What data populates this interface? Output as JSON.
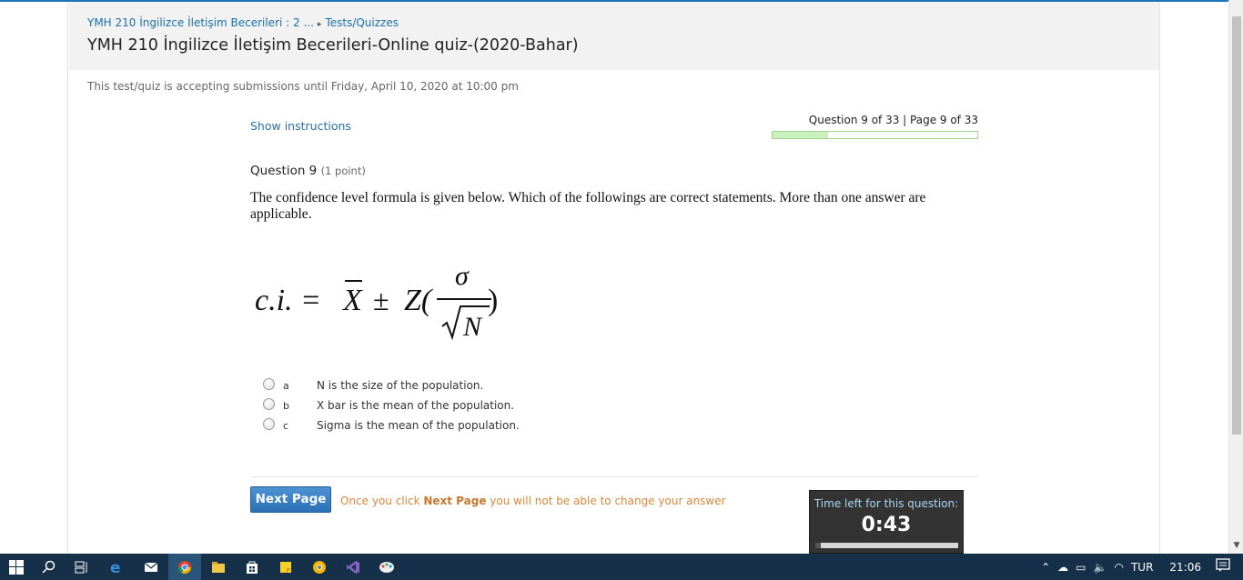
{
  "breadcrumb": {
    "course": "YMH 210 İngilizce İletişim Becerileri : 2 ...",
    "separator": "▸",
    "section": "Tests/Quizzes"
  },
  "page_title": "YMH 210 İngilizce İletişim Becerileri-Online quiz-(2020-Bahar)",
  "deadline_text": "This test/quiz is accepting submissions until Friday, April 10, 2020 at 10:00 pm",
  "show_instructions": "Show instructions",
  "progress": {
    "label": "Question 9 of 33 | Page 9 of 33",
    "current": 9,
    "total": 33
  },
  "question": {
    "heading": "Question 9",
    "points": "(1 point)",
    "text": "The confidence level formula is given below.  Which of the followings are correct statements. More than one answer are applicable.",
    "formula": {
      "lhs": "c.i. =",
      "xbar": "X",
      "pm": "±",
      "z": "Z(",
      "numerator": "σ",
      "denominator": "N",
      "close": ")"
    },
    "choices": [
      {
        "letter": "a",
        "text": "N is the size of the population."
      },
      {
        "letter": "b",
        "text": "X bar is the mean of the population."
      },
      {
        "letter": "c",
        "text": "Sigma is the mean of the population."
      }
    ]
  },
  "footer": {
    "next_button": "Next Page",
    "note_prefix": "Once you click ",
    "note_bold": "Next Page",
    "note_suffix": " you will not be able to change your answer"
  },
  "timer": {
    "label": "Time left for this question:",
    "value": "0:43",
    "remaining_fraction": 0.04
  },
  "taskbar": {
    "icons": [
      "windows-start-icon",
      "search-icon",
      "task-view-icon",
      "edge-icon",
      "mail-icon",
      "chrome-icon",
      "file-explorer-icon",
      "store-icon",
      "sticky-notes-icon",
      "chrome-canary-icon",
      "visual-studio-icon",
      "paint-icon"
    ],
    "language": "TUR",
    "time": "21:06"
  },
  "colors": {
    "accent": "#1b6fa8",
    "button": "#2c6fb5",
    "warning": "#d9873b",
    "progress_fill": "#c9f0bd",
    "taskbar": "#17304a"
  }
}
